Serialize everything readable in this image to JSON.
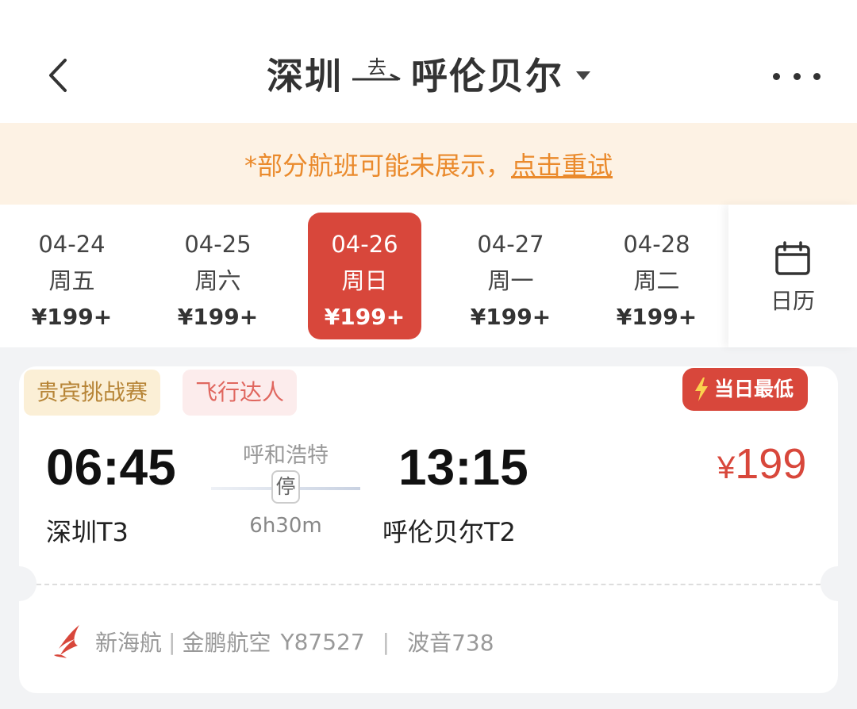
{
  "header": {
    "from_city": "深圳",
    "direction_label": "去",
    "to_city": "呼伦贝尔"
  },
  "notice": {
    "text": "*部分航班可能未展示，",
    "retry_link": "点击重试"
  },
  "dates": [
    {
      "date": "04-24",
      "weekday": "周五",
      "price": "¥199+",
      "selected": false
    },
    {
      "date": "04-25",
      "weekday": "周六",
      "price": "¥199+",
      "selected": false
    },
    {
      "date": "04-26",
      "weekday": "周日",
      "price": "¥199+",
      "selected": true
    },
    {
      "date": "04-27",
      "weekday": "周一",
      "price": "¥199+",
      "selected": false
    },
    {
      "date": "04-28",
      "weekday": "周二",
      "price": "¥199+",
      "selected": false
    }
  ],
  "calendar_label": "日历",
  "flight": {
    "tags": [
      "贵宾挑战赛",
      "飞行达人"
    ],
    "badge": "当日最低",
    "departure_time": "06:45",
    "departure_airport": "深圳T3",
    "stop_city": "呼和浩特",
    "stop_label": "停",
    "duration": "6h30m",
    "arrival_time": "13:15",
    "arrival_airport": "呼伦贝尔T2",
    "price_currency": "¥",
    "price_value": "199",
    "airline_brand": "新海航",
    "airline_name": "金鹏航空",
    "flight_number": "Y87527",
    "separator": "|",
    "aircraft": "波音738"
  },
  "colors": {
    "accent_red": "#d8473b",
    "notice_bg": "#fdf2e4",
    "notice_text": "#ea8a2c",
    "vip_tag_bg": "#fbefd6",
    "vip_tag_text": "#b78537",
    "flyer_tag_bg": "#fcecec",
    "flyer_tag_text": "#e0675f"
  },
  "icons": {
    "back": "chevron-left-icon",
    "more": "more-dots-icon",
    "calendar": "calendar-icon",
    "badge": "lightning-icon",
    "airline": "airline-logo-icon"
  }
}
